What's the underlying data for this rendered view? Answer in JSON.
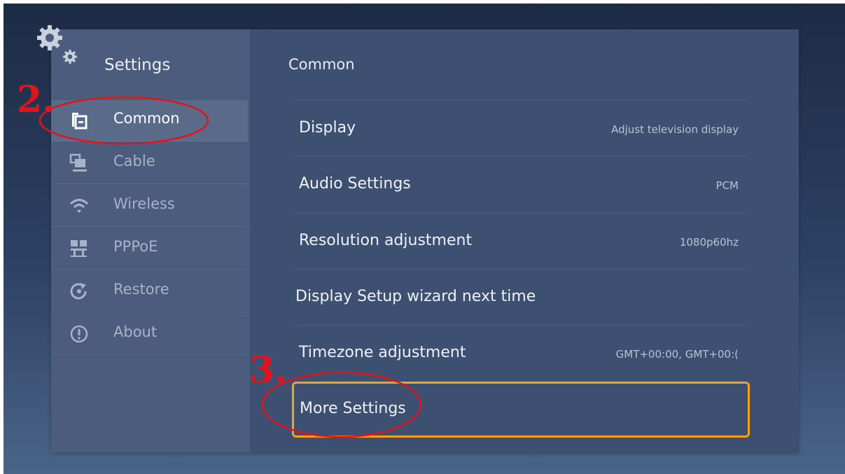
{
  "sidebar": {
    "title": "Settings",
    "items": [
      {
        "label": "Common",
        "icon": "common-icon",
        "active": true
      },
      {
        "label": "Cable",
        "icon": "cable-icon"
      },
      {
        "label": "Wireless",
        "icon": "wireless-icon"
      },
      {
        "label": "PPPoE",
        "icon": "pppoe-icon"
      },
      {
        "label": "Restore",
        "icon": "restore-icon"
      },
      {
        "label": "About",
        "icon": "about-icon"
      }
    ]
  },
  "main": {
    "title": "Common",
    "rows": [
      {
        "label": "Display",
        "value": "Adjust television display"
      },
      {
        "label": "Audio Settings",
        "value": "PCM"
      },
      {
        "label": "Resolution adjustment",
        "value": "1080p60hz"
      },
      {
        "label": "Display Setup wizard next time",
        "value": ""
      },
      {
        "label": "Timezone adjustment",
        "value": "GMT+00:00, GMT+00:("
      },
      {
        "label": "More Settings",
        "value": "",
        "focused": true
      }
    ]
  },
  "annotations": {
    "step2": "2.",
    "step3": "3."
  },
  "colors": {
    "focus_border": "#f4a21e",
    "annotation_red": "#e0151c"
  }
}
